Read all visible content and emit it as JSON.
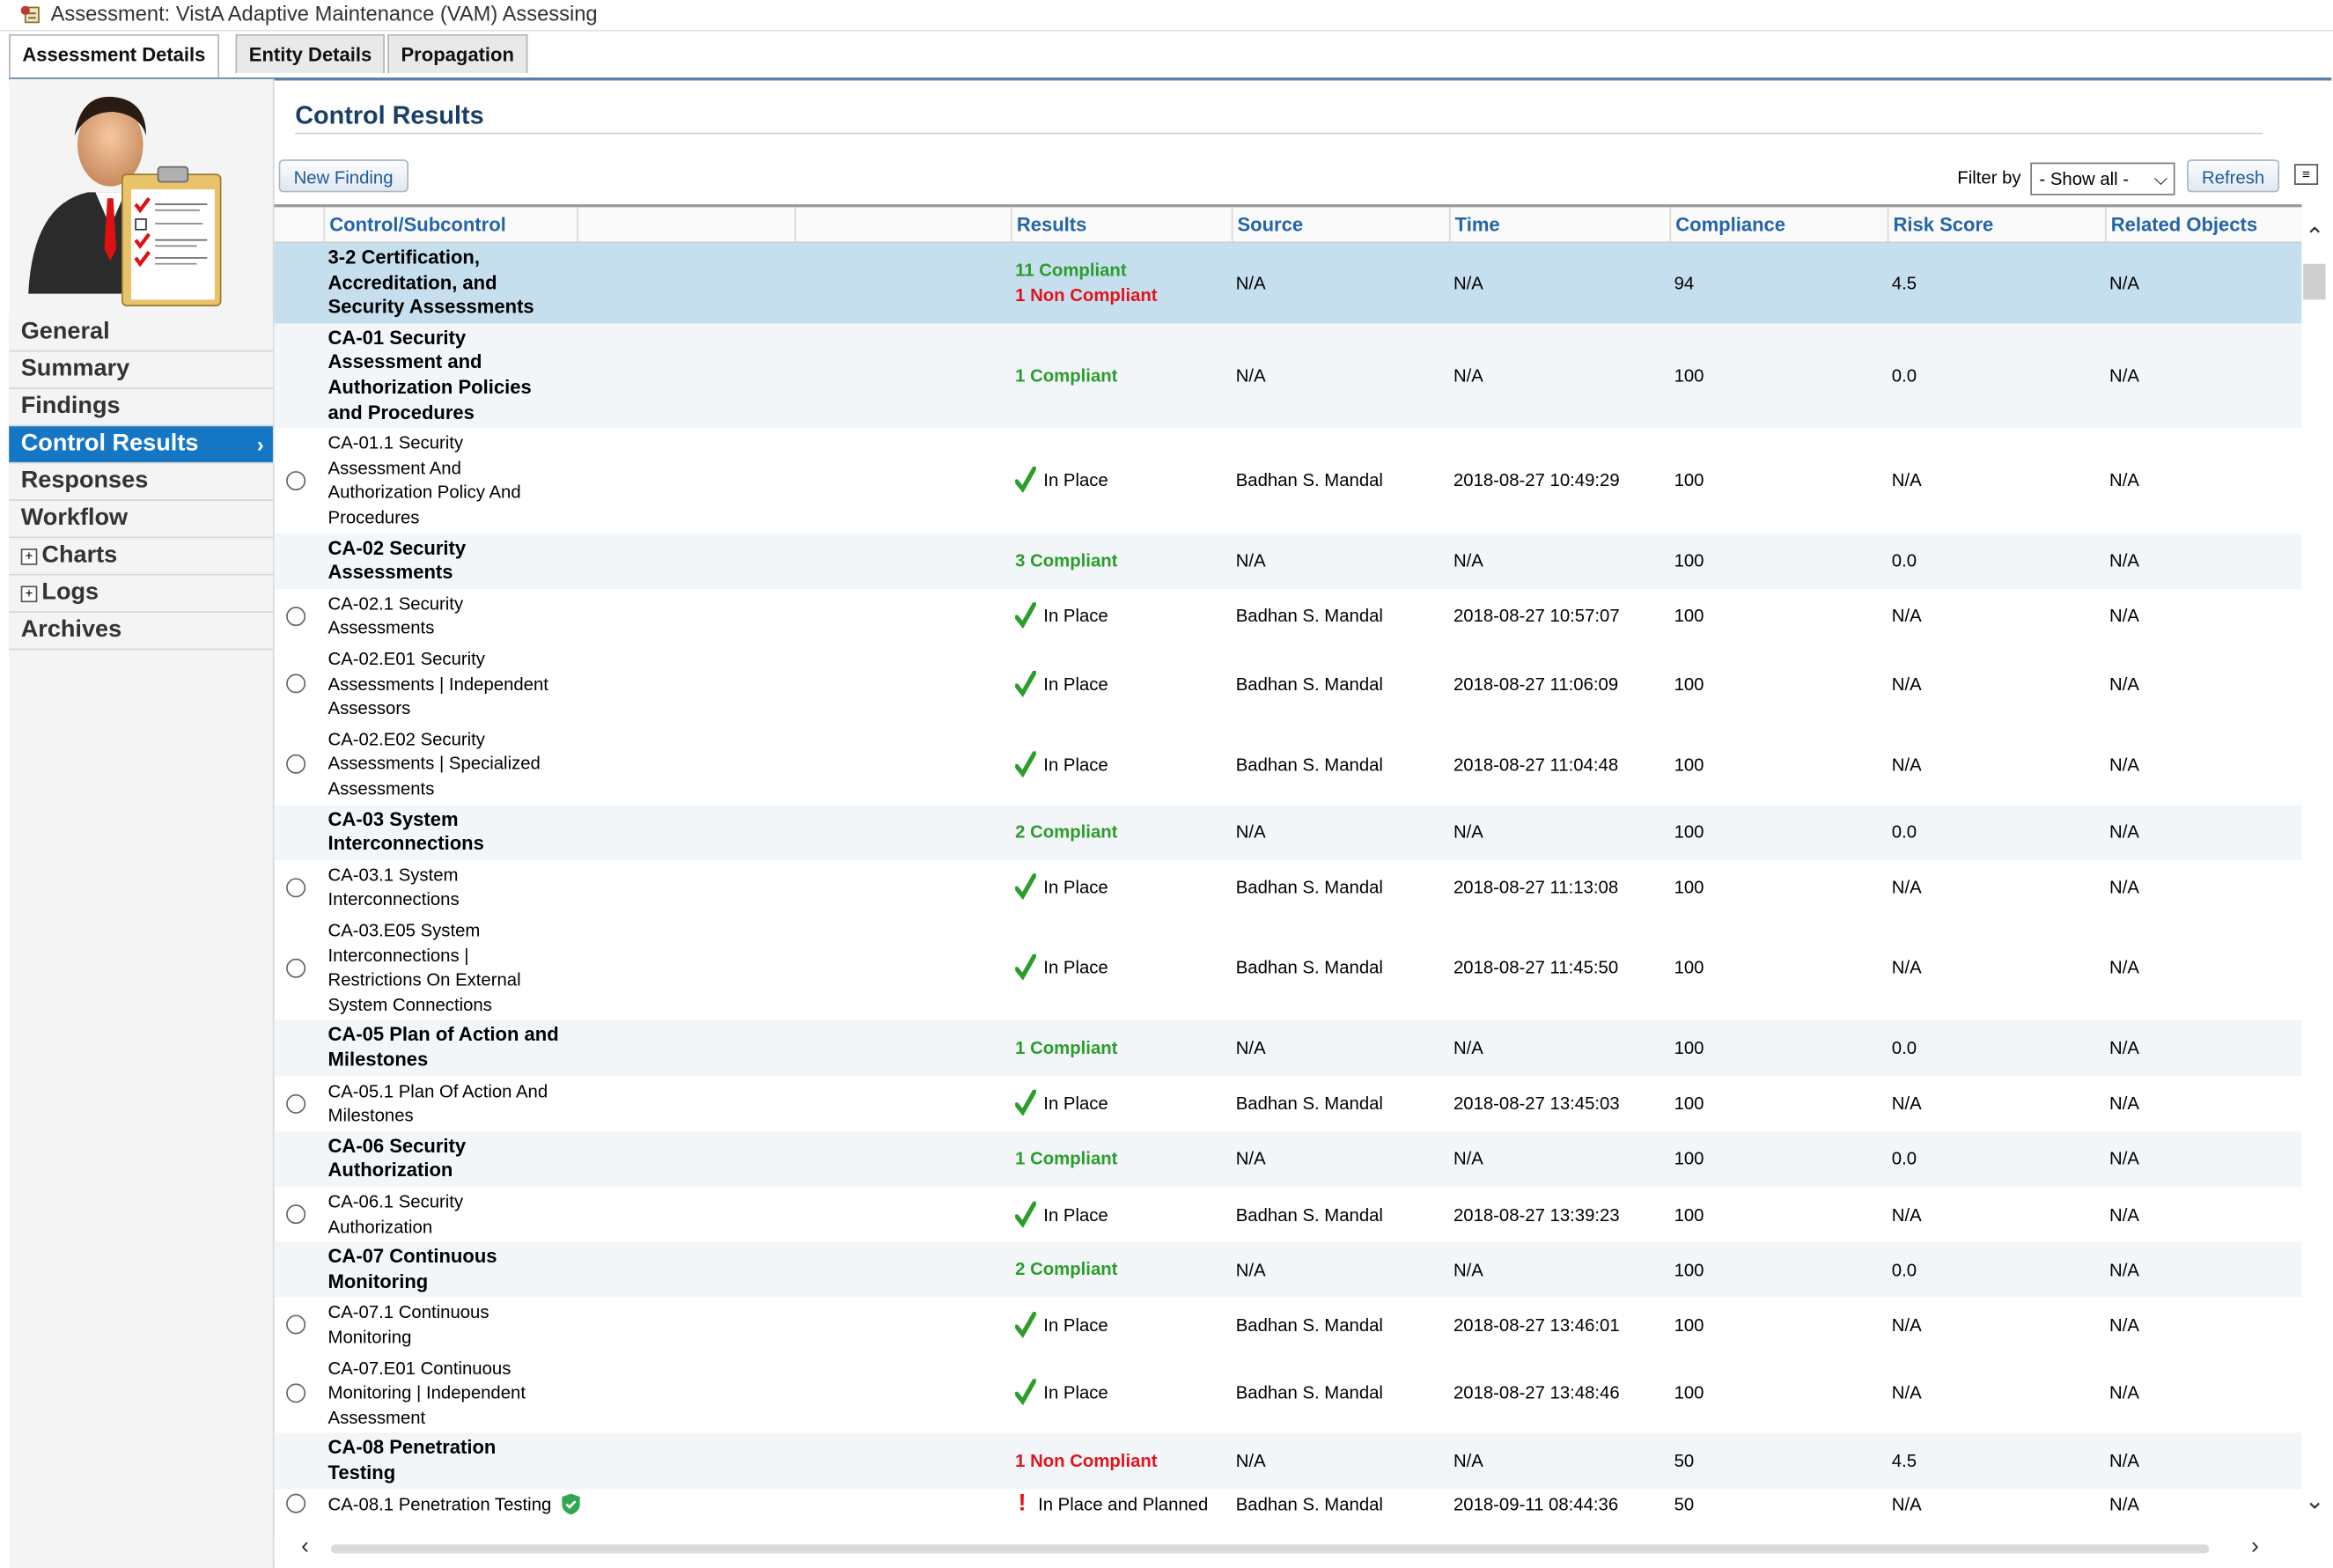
{
  "window": {
    "title": "Assessment: VistA Adaptive Maintenance (VAM) Assessing"
  },
  "tabs": [
    {
      "label": "Assessment Details",
      "active": true
    },
    {
      "label": "Entity Details",
      "active": false
    },
    {
      "label": "Propagation",
      "active": false
    }
  ],
  "sidebar": {
    "items": [
      {
        "label": "General"
      },
      {
        "label": "Summary"
      },
      {
        "label": "Findings"
      },
      {
        "label": "Control Results",
        "active": true
      },
      {
        "label": "Responses"
      },
      {
        "label": "Workflow"
      },
      {
        "label": "Charts",
        "expandable": true
      },
      {
        "label": "Logs",
        "expandable": true
      },
      {
        "label": "Archives"
      }
    ]
  },
  "main": {
    "title": "Control Results",
    "new_finding_label": "New Finding",
    "filter_label": "Filter by",
    "filter_value": "- Show all -",
    "refresh_label": "Refresh"
  },
  "grid": {
    "columns": [
      "Control/Subcontrol",
      "Results",
      "Source",
      "Time",
      "Compliance",
      "Risk Score",
      "Related Objects"
    ],
    "rows": [
      {
        "type": "group",
        "name_lines": [
          "3-2 Certification,",
          "Accreditation, and",
          "Security Assessments"
        ],
        "compliant": "11 Compliant",
        "noncompliant": "1 Non Compliant",
        "source": "N/A",
        "time": "N/A",
        "compliance": "94",
        "risk": "4.5",
        "related": "N/A"
      },
      {
        "type": "control",
        "name_lines": [
          "CA-01 Security",
          "Assessment and",
          "Authorization Policies",
          "and Procedures"
        ],
        "compliant": "1 Compliant",
        "source": "N/A",
        "time": "N/A",
        "compliance": "100",
        "risk": "0.0",
        "related": "N/A"
      },
      {
        "type": "sub",
        "name_lines": [
          "CA-01.1 Security",
          "Assessment And",
          "Authorization Policy And",
          "Procedures"
        ],
        "result": "In Place",
        "source": "Badhan S. Mandal",
        "time": "2018-08-27 10:49:29",
        "compliance": "100",
        "risk": "N/A",
        "related": "N/A"
      },
      {
        "type": "control",
        "name_lines": [
          "CA-02 Security",
          "Assessments"
        ],
        "compliant": "3 Compliant",
        "source": "N/A",
        "time": "N/A",
        "compliance": "100",
        "risk": "0.0",
        "related": "N/A"
      },
      {
        "type": "sub",
        "name_lines": [
          "CA-02.1 Security",
          "Assessments"
        ],
        "result": "In Place",
        "source": "Badhan S. Mandal",
        "time": "2018-08-27 10:57:07",
        "compliance": "100",
        "risk": "N/A",
        "related": "N/A"
      },
      {
        "type": "sub",
        "name_lines": [
          "CA-02.E01 Security",
          "Assessments | Independent",
          "Assessors"
        ],
        "result": "In Place",
        "source": "Badhan S. Mandal",
        "time": "2018-08-27 11:06:09",
        "compliance": "100",
        "risk": "N/A",
        "related": "N/A"
      },
      {
        "type": "sub",
        "name_lines": [
          "CA-02.E02 Security",
          "Assessments | Specialized",
          "Assessments"
        ],
        "result": "In Place",
        "source": "Badhan S. Mandal",
        "time": "2018-08-27 11:04:48",
        "compliance": "100",
        "risk": "N/A",
        "related": "N/A"
      },
      {
        "type": "control",
        "name_lines": [
          "CA-03 System",
          "Interconnections"
        ],
        "compliant": "2 Compliant",
        "source": "N/A",
        "time": "N/A",
        "compliance": "100",
        "risk": "0.0",
        "related": "N/A"
      },
      {
        "type": "sub",
        "name_lines": [
          "CA-03.1 System",
          "Interconnections"
        ],
        "result": "In Place",
        "source": "Badhan S. Mandal",
        "time": "2018-08-27 11:13:08",
        "compliance": "100",
        "risk": "N/A",
        "related": "N/A"
      },
      {
        "type": "sub",
        "name_lines": [
          "CA-03.E05 System",
          "Interconnections |",
          "Restrictions On External",
          "System Connections"
        ],
        "result": "In Place",
        "source": "Badhan S. Mandal",
        "time": "2018-08-27 11:45:50",
        "compliance": "100",
        "risk": "N/A",
        "related": "N/A"
      },
      {
        "type": "control",
        "name_lines": [
          "CA-05 Plan of Action and",
          "Milestones"
        ],
        "compliant": "1 Compliant",
        "source": "N/A",
        "time": "N/A",
        "compliance": "100",
        "risk": "0.0",
        "related": "N/A"
      },
      {
        "type": "sub",
        "name_lines": [
          "CA-05.1 Plan Of Action And",
          "Milestones"
        ],
        "result": "In Place",
        "source": "Badhan S. Mandal",
        "time": "2018-08-27 13:45:03",
        "compliance": "100",
        "risk": "N/A",
        "related": "N/A"
      },
      {
        "type": "control",
        "name_lines": [
          "CA-06 Security",
          "Authorization"
        ],
        "compliant": "1 Compliant",
        "source": "N/A",
        "time": "N/A",
        "compliance": "100",
        "risk": "0.0",
        "related": "N/A"
      },
      {
        "type": "sub",
        "name_lines": [
          "CA-06.1 Security",
          "Authorization"
        ],
        "result": "In Place",
        "source": "Badhan S. Mandal",
        "time": "2018-08-27 13:39:23",
        "compliance": "100",
        "risk": "N/A",
        "related": "N/A"
      },
      {
        "type": "control",
        "name_lines": [
          "CA-07 Continuous",
          "Monitoring"
        ],
        "compliant": "2 Compliant",
        "source": "N/A",
        "time": "N/A",
        "compliance": "100",
        "risk": "0.0",
        "related": "N/A"
      },
      {
        "type": "sub",
        "name_lines": [
          "CA-07.1 Continuous",
          "Monitoring"
        ],
        "result": "In Place",
        "source": "Badhan S. Mandal",
        "time": "2018-08-27 13:46:01",
        "compliance": "100",
        "risk": "N/A",
        "related": "N/A"
      },
      {
        "type": "sub",
        "name_lines": [
          "CA-07.E01 Continuous",
          "Monitoring | Independent",
          "Assessment"
        ],
        "result": "In Place",
        "source": "Badhan S. Mandal",
        "time": "2018-08-27 13:48:46",
        "compliance": "100",
        "risk": "N/A",
        "related": "N/A"
      },
      {
        "type": "control",
        "name_lines": [
          "CA-08 Penetration",
          "Testing"
        ],
        "noncompliant": "1 Non Compliant",
        "source": "N/A",
        "time": "N/A",
        "compliance": "50",
        "risk": "4.5",
        "related": "N/A"
      },
      {
        "type": "sub",
        "name_lines": [
          "CA-08.1 Penetration Testing"
        ],
        "result": "In Place and Planned",
        "warning": true,
        "shield": true,
        "source": "Badhan S. Mandal",
        "time": "2018-09-11 08:44:36",
        "compliance": "50",
        "risk": "N/A",
        "related": "N/A"
      }
    ]
  },
  "colors": {
    "accent": "#1576c4",
    "compliant": "#2a9d2a",
    "noncompliant": "#e2141a",
    "header_text": "#2464a8",
    "selected_row": "#c6dfee"
  }
}
